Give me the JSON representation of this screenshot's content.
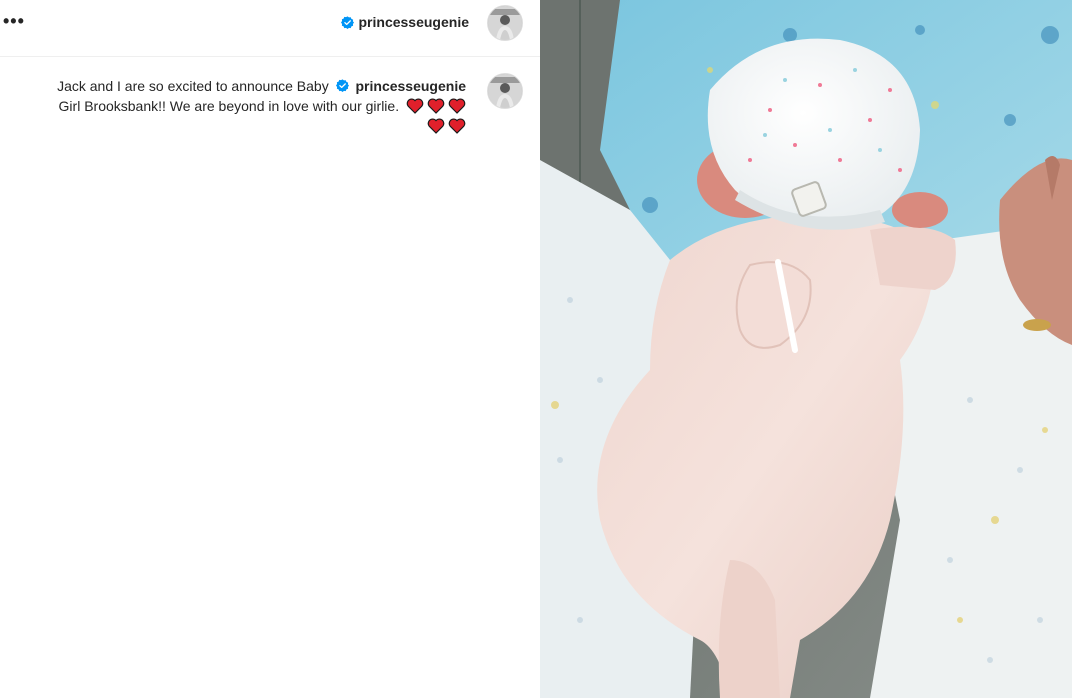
{
  "header": {
    "more_label": "•••",
    "username": "princesseugenie",
    "verified_icon": "verified-badge-icon"
  },
  "caption": {
    "text_part1": "Jack and I are so excited to announce Baby",
    "username": "princesseugenie",
    "text_part2": "Girl Brooksbank!! We are beyond in love with our girlie.",
    "hearts_count": 5,
    "heart_icon": "red-heart-emoji"
  },
  "colors": {
    "verified_blue": "#0095f6",
    "heart_red": "#e0202b",
    "text": "#262626"
  },
  "photo": {
    "subject_icon": "newborn-photo"
  }
}
